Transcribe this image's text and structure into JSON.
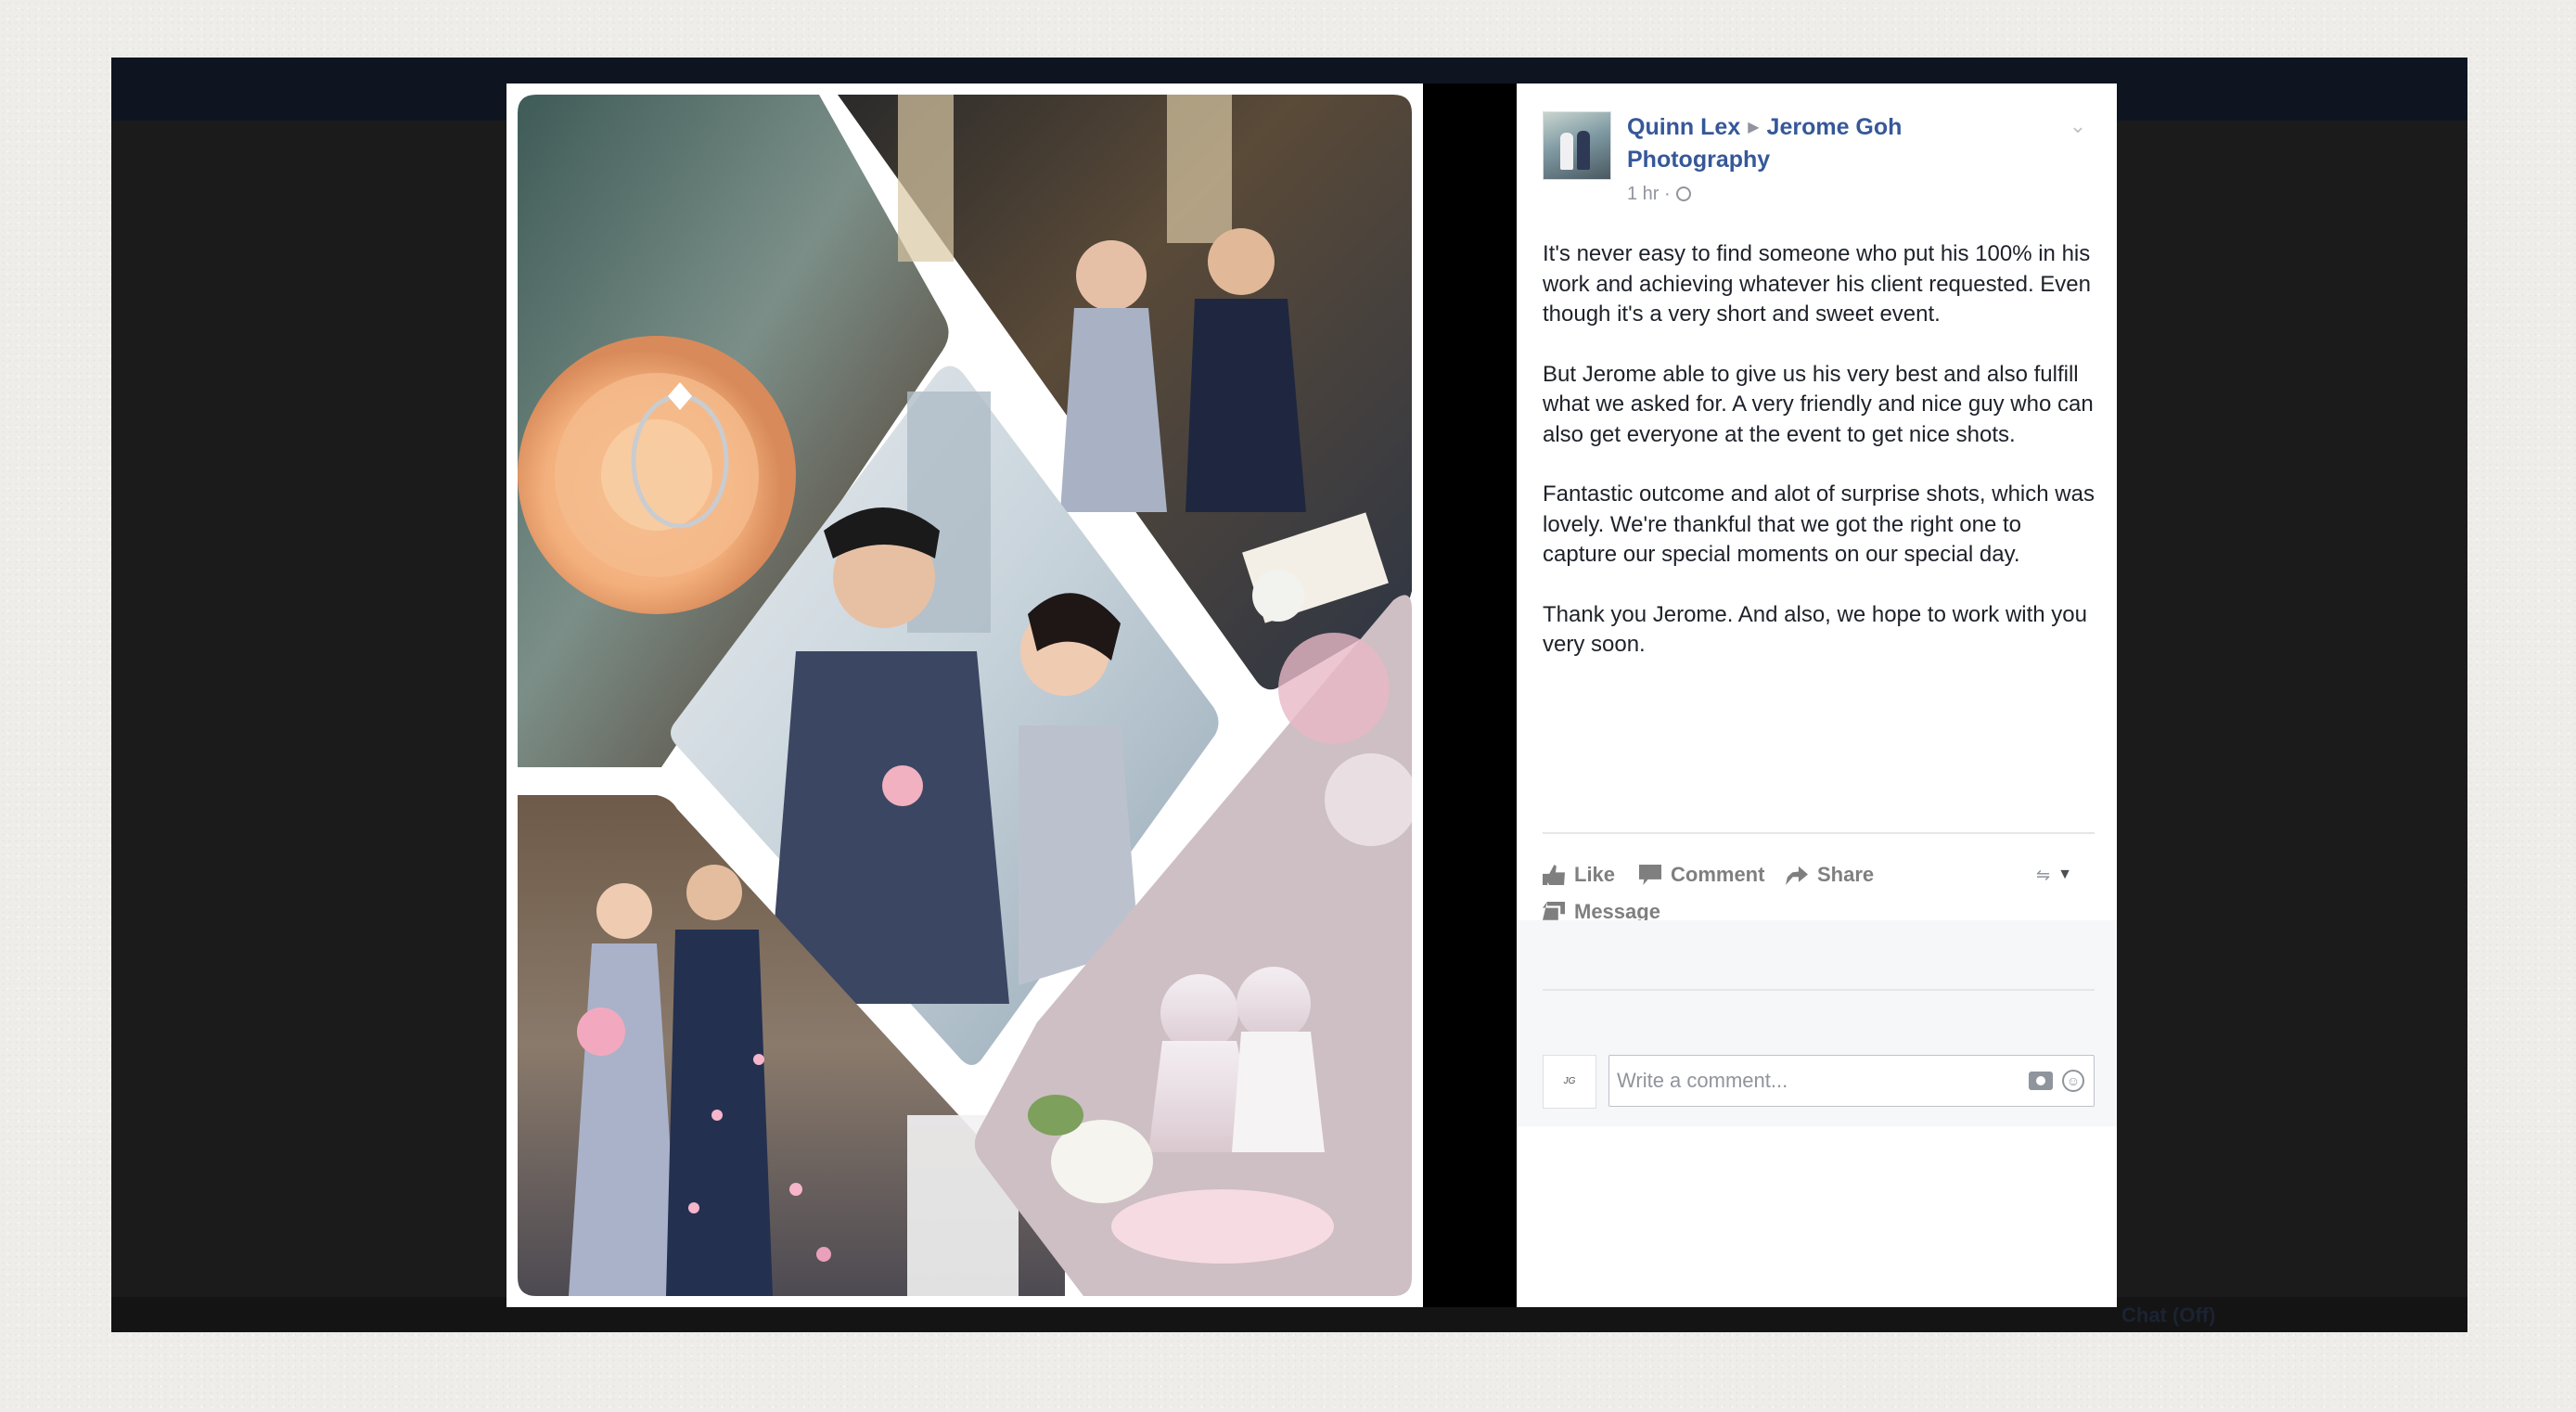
{
  "post": {
    "author": "Quinn Lex",
    "target_page": "Jerome Goh Photography",
    "time": "1 hr",
    "paragraphs": [
      "It's never easy to find someone who put his 100% in his work and achieving whatever his client requested. Even though it's a very short and sweet event.",
      "But Jerome able to give us his very best and also fulfill what we asked for. A very friendly and nice guy who can also get everyone at the event to get nice shots.",
      "Fantastic outcome and alot of surprise shots, which was lovely. We're thankful that we got the right one to capture our special moments on our special day.",
      "Thank you Jerome. And also, we hope to work with you very soon."
    ]
  },
  "actions": {
    "like": "Like",
    "comment": "Comment",
    "share": "Share",
    "message": "Message"
  },
  "comment_box": {
    "placeholder": "Write a comment..."
  },
  "underlay": {
    "chat": "Chat (Off)"
  },
  "photo_tiles": [
    {
      "subject": "engagement ring on peach carnation"
    },
    {
      "subject": "couple seated at signing table"
    },
    {
      "subject": "couple portrait in front of city buildings"
    },
    {
      "subject": "couple walking with petals"
    },
    {
      "subject": "porcelain couple figurines with flowers"
    }
  ],
  "colors": {
    "link": "#365899",
    "text": "#1d2129",
    "muted": "#90949c",
    "action": "#7f7f7f",
    "overlay": "#1d1d1d"
  }
}
